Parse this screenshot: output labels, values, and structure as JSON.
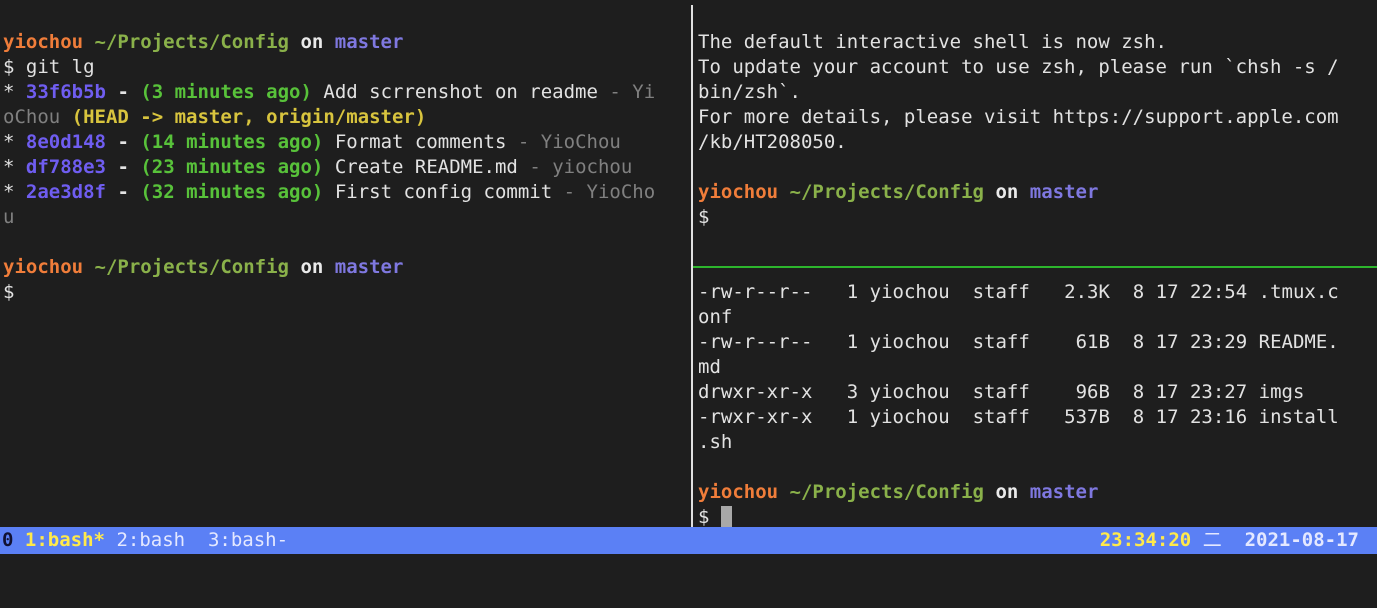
{
  "colors": {
    "user": "#f07d3a",
    "path": "#8ab14a",
    "branch": "#7f78e0",
    "hash": "#6f5df0",
    "time_ago": "#58c23a",
    "refs": "#d8c43e",
    "status_bar": "#5b80f5",
    "active_border": "#2db52d",
    "border": "#e0e0e0"
  },
  "left_pane": {
    "prompt1": {
      "user": "yiochou",
      "path": "~/Projects/Config",
      "on": "on",
      "branch": "master"
    },
    "command": "$ git lg",
    "commits": [
      {
        "star": "*",
        "hash": "33f6b5b",
        "dash": "-",
        "when": "(3 minutes ago)",
        "msg": "Add scrrenshot on readme",
        "sep": "-",
        "author": "Yi",
        "wrap": "oChou",
        "refs": "(HEAD -> master, origin/master)"
      },
      {
        "star": "*",
        "hash": "8e0d148",
        "dash": "-",
        "when": "(14 minutes ago)",
        "msg": "Format comments",
        "sep": "-",
        "author": "YioChou"
      },
      {
        "star": "*",
        "hash": "df788e3",
        "dash": "-",
        "when": "(23 minutes ago)",
        "msg": "Create README.md",
        "sep": "-",
        "author": "yiochou"
      },
      {
        "star": "*",
        "hash": "2ae3d8f",
        "dash": "-",
        "when": "(32 minutes ago)",
        "msg": "First config commit",
        "sep": "-",
        "author": "YioCho",
        "wrap": "u"
      }
    ],
    "prompt2": {
      "user": "yiochou",
      "path": "~/Projects/Config",
      "on": "on",
      "branch": "master"
    },
    "dollar": "$"
  },
  "right_top_pane": {
    "lines": [
      "The default interactive shell is now zsh.",
      "To update your account to use zsh, please run `chsh -s /",
      "bin/zsh`.",
      "For more details, please visit https://support.apple.com",
      "/kb/HT208050."
    ],
    "prompt": {
      "user": "yiochou",
      "path": "~/Projects/Config",
      "on": "on",
      "branch": "master"
    },
    "dollar": "$"
  },
  "right_bottom_pane": {
    "listing": [
      {
        "perm": "-rw-r--r--",
        "links": "1",
        "owner": "yiochou",
        "group": "staff",
        "size": "2.3K",
        "date": "8 17 22:54",
        "name": ".tmux.c",
        "wrap": "onf"
      },
      {
        "perm": "-rw-r--r--",
        "links": "1",
        "owner": "yiochou",
        "group": "staff",
        "size": "61B",
        "date": "8 17 23:29",
        "name": "README.",
        "wrap": "md"
      },
      {
        "perm": "drwxr-xr-x",
        "links": "3",
        "owner": "yiochou",
        "group": "staff",
        "size": "96B",
        "date": "8 17 23:27",
        "name": "imgs"
      },
      {
        "perm": "-rwxr-xr-x",
        "links": "1",
        "owner": "yiochou",
        "group": "staff",
        "size": "537B",
        "date": "8 17 23:16",
        "name": "install",
        "wrap": ".sh"
      }
    ],
    "prompt": {
      "user": "yiochou",
      "path": "~/Projects/Config",
      "on": "on",
      "branch": "master"
    },
    "dollar": "$"
  },
  "status_bar": {
    "session": "0",
    "windows": [
      {
        "label": "1:bash*",
        "active": true
      },
      {
        "label": "2:bash",
        "active": false
      },
      {
        "label": "3:bash-",
        "active": false
      }
    ],
    "time": "23:34:20",
    "weekday": "二",
    "date": "2021-08-17"
  }
}
